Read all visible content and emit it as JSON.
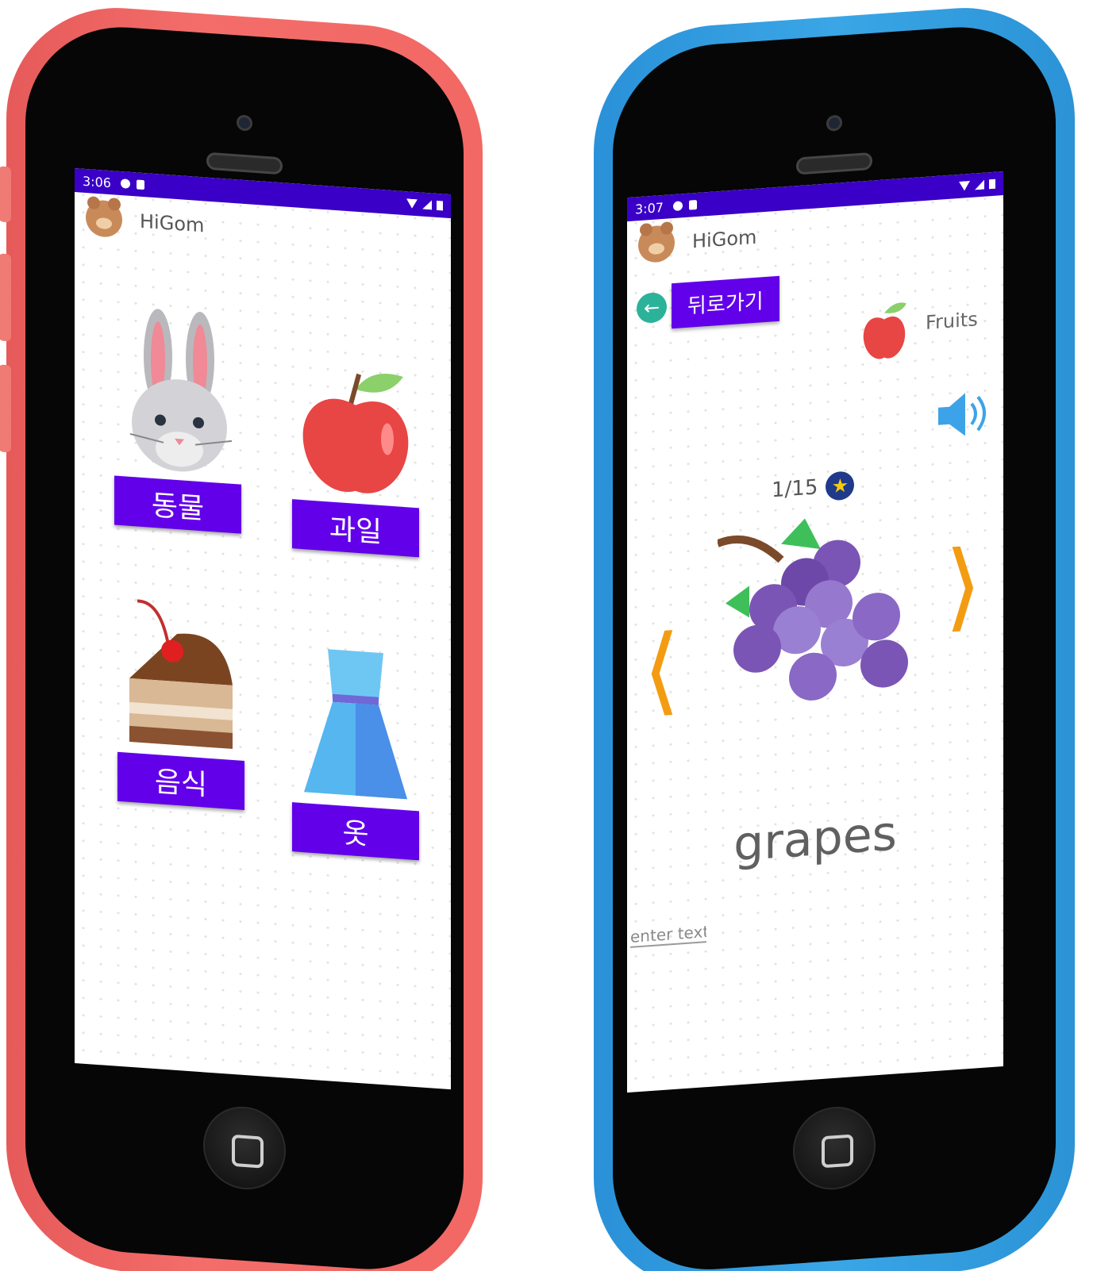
{
  "left_phone": {
    "status_time": "3:06",
    "app_title": "HiGom",
    "categories": [
      {
        "label": "동물",
        "icon": "rabbit-icon"
      },
      {
        "label": "과일",
        "icon": "apple-icon"
      },
      {
        "label": "음식",
        "icon": "cake-icon"
      },
      {
        "label": "옷",
        "icon": "dress-icon"
      }
    ]
  },
  "right_phone": {
    "status_time": "3:07",
    "app_title": "HiGom",
    "back_label": "뒤로가기",
    "category_label": "Fruits",
    "counter": "1/15",
    "word": "grapes",
    "input_placeholder": "enter text"
  },
  "colors": {
    "primary": "#6200ea",
    "status_bar": "#3a00c7",
    "arrow": "#f39c12",
    "left_phone_shell": "#f26864",
    "right_phone_shell": "#3aa6e6"
  }
}
